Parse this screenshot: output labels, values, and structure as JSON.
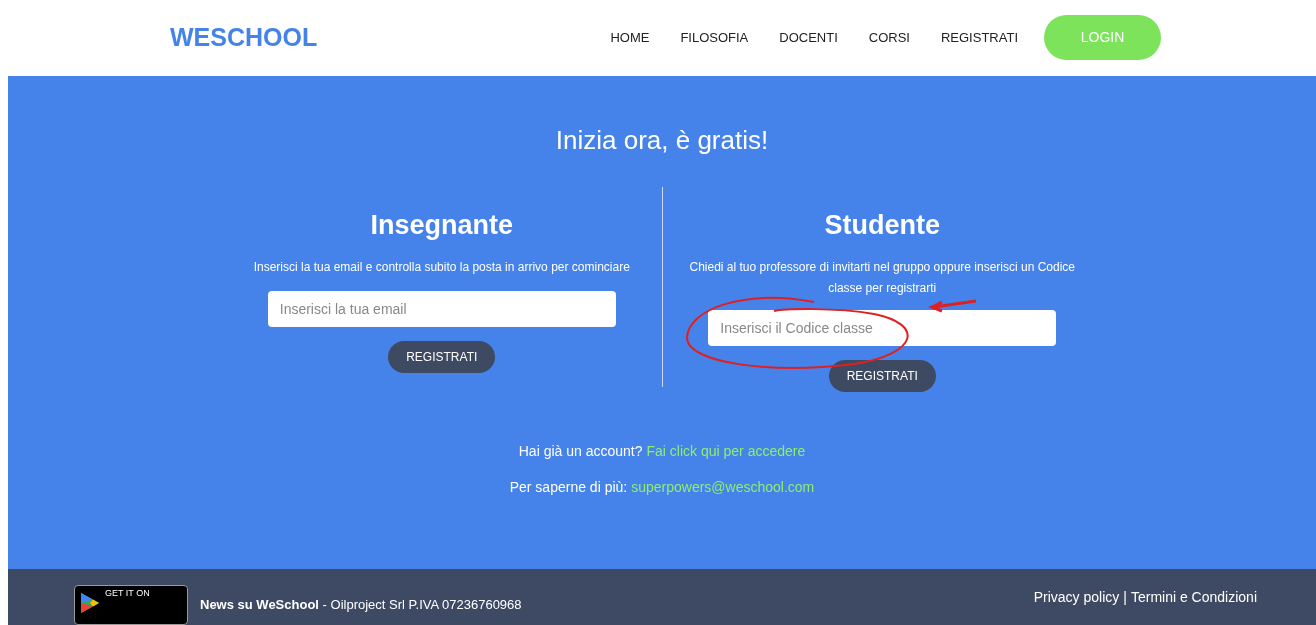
{
  "header": {
    "logo": "WESCHOOL",
    "nav": [
      "HOME",
      "FILOSOFIA",
      "DOCENTI",
      "CORSI",
      "REGISTRATI"
    ],
    "login": "LOGIN"
  },
  "hero": {
    "title": "Inizia ora, è gratis!",
    "panels": [
      {
        "title": "Insegnante",
        "text": "Inserisci la tua email e controlla subito la posta in arrivo per cominciare",
        "placeholder": "Inserisci la tua email",
        "button": "REGISTRATI"
      },
      {
        "title": "Studente",
        "text": "Chiedi al tuo professore di invitarti nel gruppo oppure inserisci un Codice classe per registrarti",
        "placeholder": "Inserisci il Codice classe",
        "button": "REGISTRATI"
      }
    ],
    "annotation": {
      "kind": "circle-arrow"
    },
    "account_text": "Hai già un account?",
    "account_link": "Fai click qui per accedere",
    "info_text": "Per saperne di più:",
    "info_link": "superpowers@weschool.com"
  },
  "footer": {
    "badge_small": "GET IT ON",
    "news_bold": "News su WeSchool",
    "news_text": " - Oilproject Srl P.IVA 07236760968",
    "links": [
      "Privacy policy",
      "|",
      "Termini e Condizioni"
    ]
  }
}
